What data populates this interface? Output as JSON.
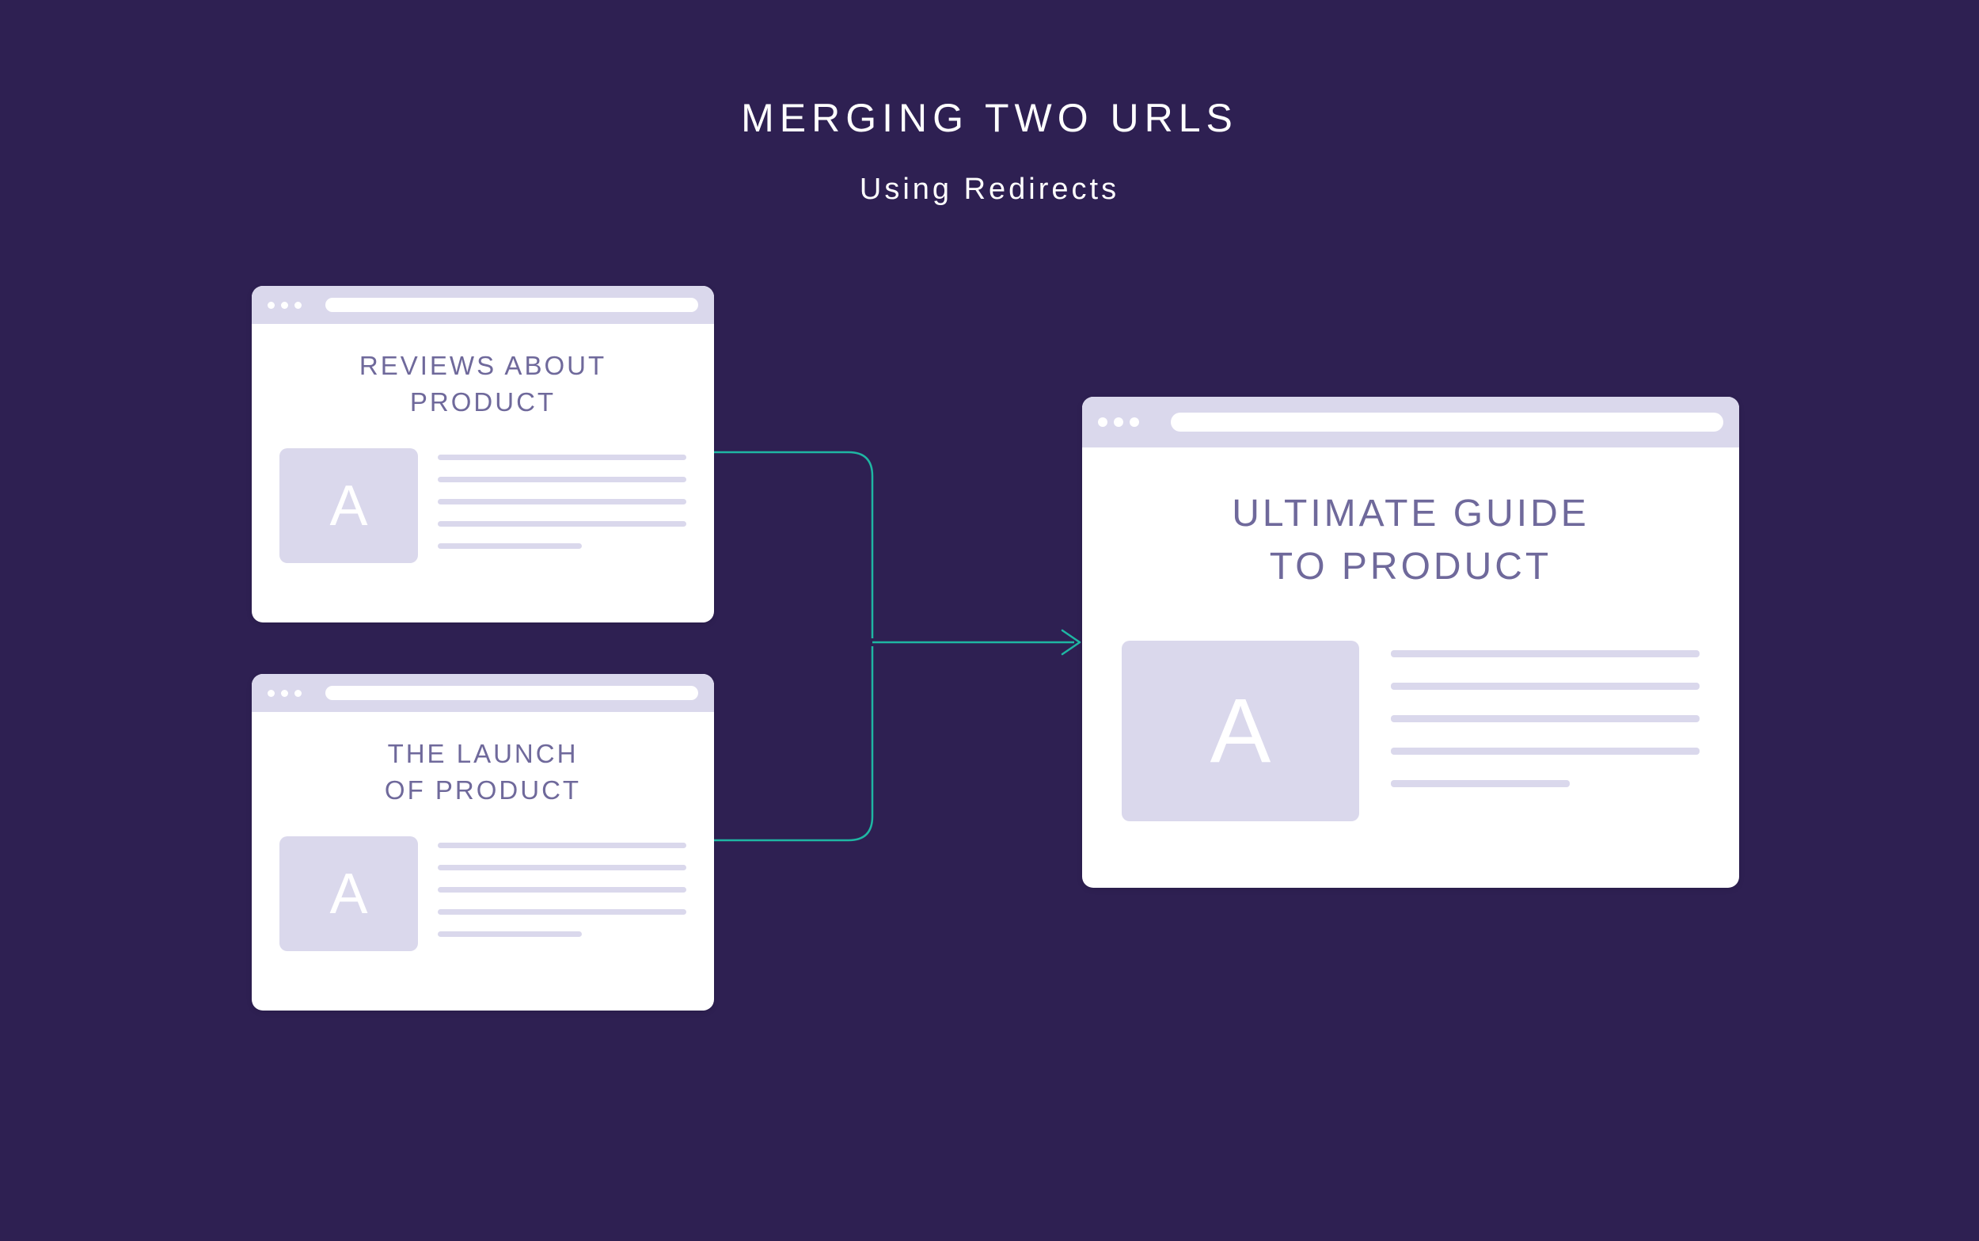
{
  "header": {
    "title": "MERGING TWO URLS",
    "subtitle": "Using Redirects"
  },
  "cards": {
    "reviews": {
      "title_line1": "REVIEWS ABOUT",
      "title_line2": "PRODUCT",
      "image_letter": "A"
    },
    "launch": {
      "title_line1": "THE LAUNCH",
      "title_line2": "OF PRODUCT",
      "image_letter": "A"
    },
    "ultimate": {
      "title_line1": "ULTIMATE GUIDE",
      "title_line2": "TO PRODUCT",
      "image_letter": "A"
    }
  },
  "colors": {
    "background": "#2e2052",
    "card_bg": "#ffffff",
    "accent": "#dad8ec",
    "text": "#6f699b",
    "connector": "#1fb6a3"
  }
}
